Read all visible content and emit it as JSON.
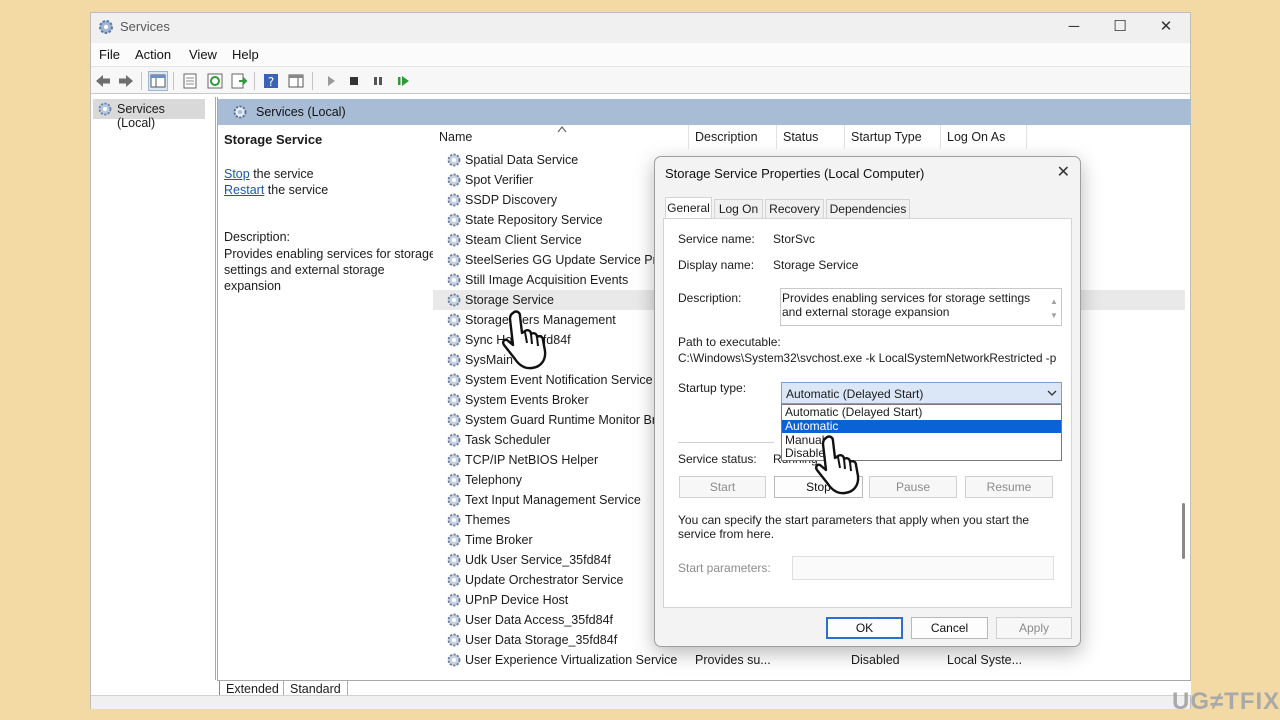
{
  "window": {
    "title": "Services",
    "controls": {
      "minimize": "─",
      "maximize": "☐",
      "close": "✕"
    }
  },
  "menu": [
    "File",
    "Action",
    "View",
    "Help"
  ],
  "tree": {
    "item": "Services (Local)"
  },
  "right_pane": {
    "header": "Services (Local)"
  },
  "details": {
    "title": "Storage Service",
    "stop_link": "Stop",
    "stop_rest": " the service",
    "restart_link": "Restart",
    "restart_rest": " the service",
    "description_label": "Description:",
    "description": "Provides enabling services for storage settings and external storage expansion"
  },
  "columns": [
    "Name",
    "Description",
    "Status",
    "Startup Type",
    "Log On As"
  ],
  "services": [
    {
      "name": "Spatial Data Service"
    },
    {
      "name": "Spot Verifier"
    },
    {
      "name": "SSDP Discovery"
    },
    {
      "name": "State Repository Service"
    },
    {
      "name": "Steam Client Service"
    },
    {
      "name": "SteelSeries GG Update Service Prox"
    },
    {
      "name": "Still Image Acquisition Events"
    },
    {
      "name": "Storage Service",
      "selected": true
    },
    {
      "name": "Storage Tiers Management"
    },
    {
      "name": "Sync Host_35fd84f"
    },
    {
      "name": "SysMain"
    },
    {
      "name": "System Event Notification Service"
    },
    {
      "name": "System Events Broker"
    },
    {
      "name": "System Guard Runtime Monitor Br"
    },
    {
      "name": "Task Scheduler"
    },
    {
      "name": "TCP/IP NetBIOS Helper"
    },
    {
      "name": "Telephony"
    },
    {
      "name": "Text Input Management Service"
    },
    {
      "name": "Themes"
    },
    {
      "name": "Time Broker"
    },
    {
      "name": "Udk User Service_35fd84f"
    },
    {
      "name": "Update Orchestrator Service"
    },
    {
      "name": "UPnP Device Host"
    },
    {
      "name": "User Data Access_35fd84f"
    },
    {
      "name": "User Data Storage_35fd84f"
    },
    {
      "name": "User Experience Virtualization Service",
      "description": "Provides su...",
      "startup": "Disabled",
      "logon": "Local Syste..."
    }
  ],
  "bottom_tabs": [
    "Extended",
    "Standard"
  ],
  "dialog": {
    "title": "Storage Service Properties (Local Computer)",
    "tabs": [
      "General",
      "Log On",
      "Recovery",
      "Dependencies"
    ],
    "service_name_label": "Service name:",
    "service_name": "StorSvc",
    "display_name_label": "Display name:",
    "display_name": "Storage Service",
    "description_label": "Description:",
    "description": "Provides enabling services for storage settings and external storage expansion",
    "path_label": "Path to executable:",
    "path": "C:\\Windows\\System32\\svchost.exe -k LocalSystemNetworkRestricted -p",
    "startup_label": "Startup type:",
    "startup_value": "Automatic (Delayed Start)",
    "startup_options": [
      "Automatic (Delayed Start)",
      "Automatic",
      "Manual",
      "Disabled"
    ],
    "highlighted_option": "Automatic",
    "status_label": "Service status:",
    "status_value": "Running",
    "buttons": {
      "start": "Start",
      "stop": "Stop",
      "pause": "Pause",
      "resume": "Resume"
    },
    "hint": "You can specify the start parameters that apply when you start the service from here.",
    "params_label": "Start parameters:",
    "footer": {
      "ok": "OK",
      "cancel": "Cancel",
      "apply": "Apply"
    }
  },
  "watermark": "UG≠TFIX",
  "colors": {
    "background": "#f3d9a4",
    "pane_header": "#a9bcd6",
    "selection": "#0a63d6",
    "link": "#1a55b5"
  }
}
